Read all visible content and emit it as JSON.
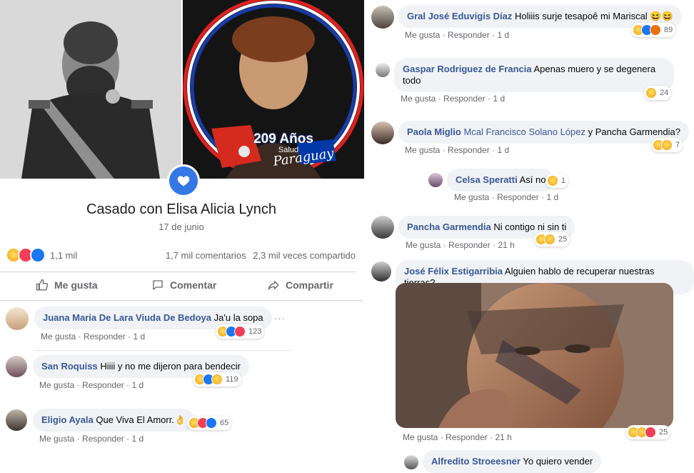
{
  "post": {
    "overlay_line1": "209 Años",
    "overlay_line2": "Salud",
    "overlay_line3": "Paraguay",
    "title": "Casado con Elisa Alicia Lynch",
    "date": "17 de junio",
    "reaction_count": "1,1 mil",
    "comments_count": "1,7 mil comentarios",
    "shares_count": "2,3 mil veces compartido",
    "actions": {
      "like": "Me gusta",
      "comment": "Comentar",
      "share": "Compartir"
    }
  },
  "meta_labels": {
    "like": "Me gusta",
    "reply": "Responder",
    "dot": "·"
  },
  "left_comments": [
    {
      "name": "Juana Maria De Lara Viuda De Bedoya",
      "text": "Ja'u la sopa",
      "time": "1 d",
      "count": "123",
      "more": "···"
    },
    {
      "name": "San Roquiss",
      "text": "Hiiii y no me dijeron para bendecir",
      "time": "1 d",
      "count": "119"
    },
    {
      "name": "Eligio Ayala",
      "text": "Que Viva El Amorr.👌",
      "time": "1 d",
      "count": "65"
    }
  ],
  "right_comments": [
    {
      "name": "Gral José Eduvigis Díaz",
      "text": "Holiiis surje tesapoê mi Mariscal 😆😆",
      "time": "1 d",
      "count": "89"
    },
    {
      "name": "Gaspar Rodriguez de Francia",
      "text": "Apenas muero y se degenera todo",
      "time": "1 d",
      "count": "24"
    },
    {
      "name": "Paola Miglio",
      "tag": "Mcal Francisco Solano López",
      "text_rest": "y Pancha Garmendia?",
      "time": "1 d",
      "count": "7"
    },
    {
      "name": "Celsa Speratti",
      "text": "Así no",
      "time": "1 d",
      "count": "1"
    },
    {
      "name": "Pancha Garmendia",
      "text": "Ni contigo ni sin ti",
      "time": "21 h",
      "count": "25"
    },
    {
      "name": "José Félix Estigarribia",
      "text": "Alguien hablo de recuperar nuestras tierras?",
      "time": "21 h",
      "count": "25"
    },
    {
      "name": "Alfredito Stroeesner",
      "text": "Yo quiero vender"
    }
  ],
  "colors": {
    "link": "#385898",
    "bubble": "#f0f2f5",
    "meta": "#65676b",
    "accent": "#1877f2",
    "love": "#f33e58",
    "haha": "#f7b125",
    "angry": "#e9710f"
  },
  "icons": [
    "life-event-heart-icon",
    "like-outline-icon",
    "comment-outline-icon",
    "share-outline-icon",
    "haha-reaction-icon",
    "love-reaction-icon",
    "like-reaction-icon",
    "angry-reaction-icon",
    "wow-reaction-icon"
  ]
}
